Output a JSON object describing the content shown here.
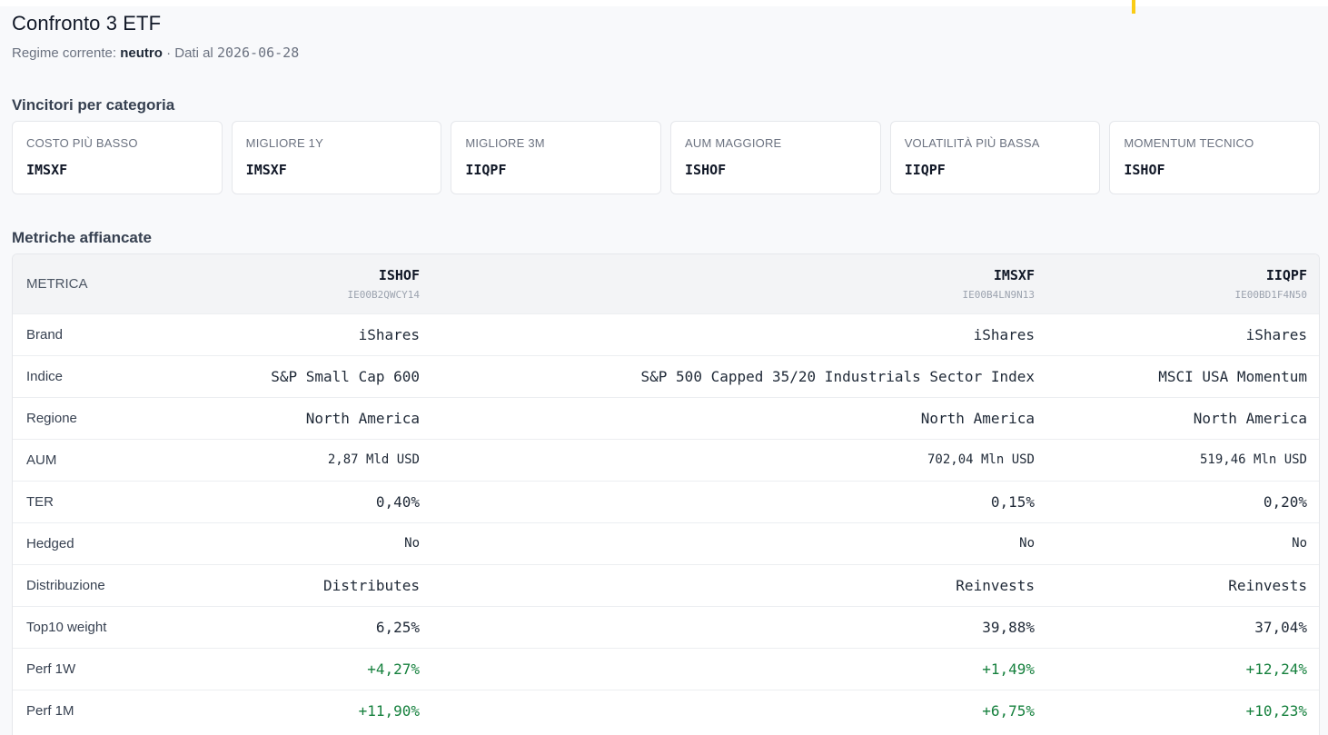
{
  "header": {
    "title": "Confronto 3 ETF",
    "regime_label": "Regime corrente:",
    "regime_value": "neutro",
    "date_prefix": "· Dati al",
    "date_value": "2026-06-28"
  },
  "winners": {
    "section_title": "Vincitori per categoria",
    "cards": [
      {
        "label": "COSTO PIÙ BASSO",
        "value": "IMSXF"
      },
      {
        "label": "MIGLIORE 1Y",
        "value": "IMSXF"
      },
      {
        "label": "MIGLIORE 3M",
        "value": "IIQPF"
      },
      {
        "label": "AUM MAGGIORE",
        "value": "ISHOF"
      },
      {
        "label": "VOLATILITÀ PIÙ BASSA",
        "value": "IIQPF"
      },
      {
        "label": "MOMENTUM TECNICO",
        "value": "ISHOF"
      }
    ]
  },
  "metrics": {
    "section_title": "Metriche affiancate",
    "metric_header": "METRICA",
    "etfs": [
      {
        "ticker": "ISHOF",
        "isin": "IE00B2QWCY14"
      },
      {
        "ticker": "IMSXF",
        "isin": "IE00B4LN9N13"
      },
      {
        "ticker": "IIQPF",
        "isin": "IE00BD1F4N50"
      }
    ],
    "rows": [
      {
        "name": "Brand",
        "values": [
          "iShares",
          "iShares",
          "iShares"
        ]
      },
      {
        "name": "Indice",
        "values": [
          "S&P Small Cap 600",
          "S&P 500 Capped 35/20 Industrials Sector Index",
          "MSCI USA Momentum"
        ]
      },
      {
        "name": "Regione",
        "values": [
          "North America",
          "North America",
          "North America"
        ]
      },
      {
        "name": "AUM",
        "values": [
          "2,87 Mld USD",
          "702,04 Mln USD",
          "519,46 Mln USD"
        ]
      },
      {
        "name": "TER",
        "values": [
          "0,40%",
          "0,15%",
          "0,20%"
        ]
      },
      {
        "name": "Hedged",
        "values": [
          "No",
          "No",
          "No"
        ]
      },
      {
        "name": "Distribuzione",
        "values": [
          "Distributes",
          "Reinvests",
          "Reinvests"
        ]
      },
      {
        "name": "Top10 weight",
        "values": [
          "6,25%",
          "39,88%",
          "37,04%"
        ]
      },
      {
        "name": "Perf 1W",
        "values": [
          "+4,27%",
          "+1,49%",
          "+12,24%"
        ]
      },
      {
        "name": "Perf 1M",
        "values": [
          "+11,90%",
          "+6,75%",
          "+10,23%"
        ]
      }
    ]
  },
  "colors": {
    "positive": "#15803d",
    "background": "#f8f9fb",
    "marker": "#facc15"
  }
}
